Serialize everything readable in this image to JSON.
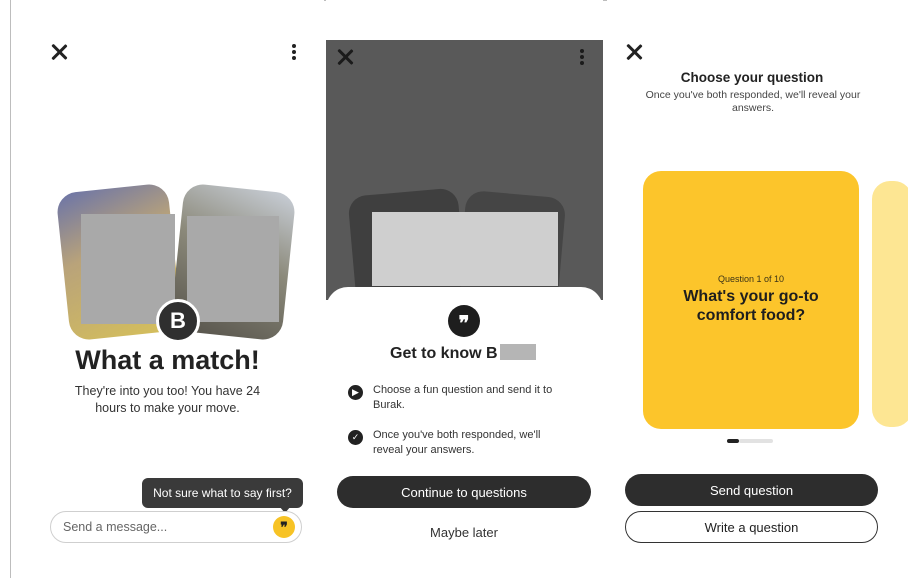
{
  "match_screen": {
    "logo_glyph": "B",
    "title": "What a match!",
    "subtitle": "They're into you too! You have 24 hours to make your move.",
    "tooltip": "Not sure what to say first?",
    "message_placeholder": "Send a message...",
    "quote_glyph": "❞"
  },
  "get_to_know_sheet": {
    "quote_glyph": "❞",
    "title": "Get to know B",
    "bullets": [
      {
        "icon": "▶",
        "text": "Choose a fun question and send it to Burak."
      },
      {
        "icon": "✓",
        "text": "Once you've both responded, we'll reveal your answers."
      }
    ],
    "primary_button": "Continue to questions",
    "secondary_button": "Maybe later"
  },
  "question_picker": {
    "title": "Choose your question",
    "subtitle": "Once you've both responded, we'll reveal your answers.",
    "card": {
      "counter": "Question 1 of 10",
      "question": "What's your go-to comfort food?"
    },
    "primary_button": "Send question",
    "secondary_button": "Write a question"
  },
  "colors": {
    "accent_yellow": "#fcc52b",
    "dark_button": "#2d2d2d",
    "overlay": "#595959"
  }
}
